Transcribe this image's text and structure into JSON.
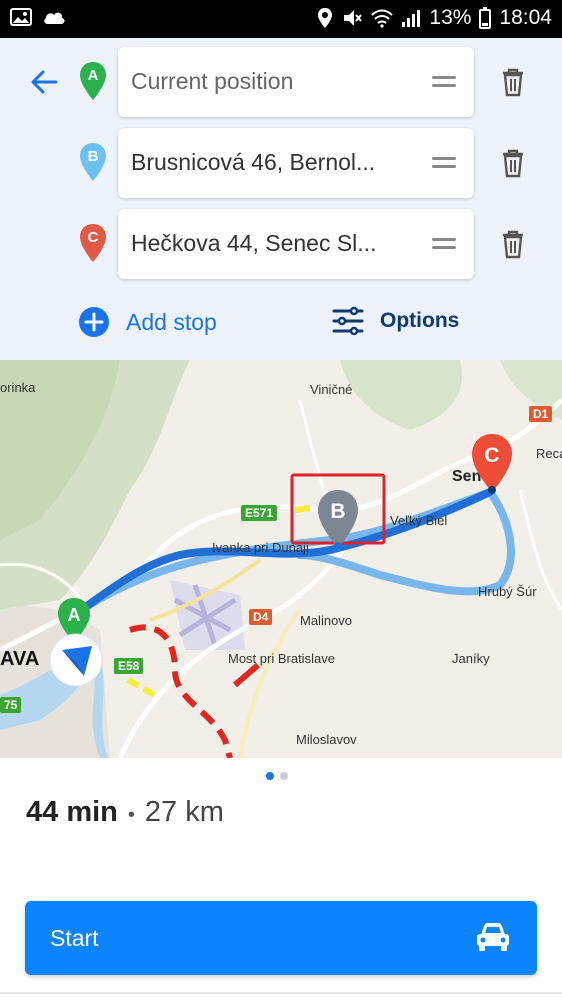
{
  "status_bar": {
    "battery": "13%",
    "time": "18:04",
    "icons": [
      "image-icon",
      "cloud-icon",
      "location-icon",
      "mute-icon",
      "wifi-icon",
      "signal-icon",
      "battery-icon"
    ]
  },
  "route": {
    "stops": [
      {
        "marker": "A",
        "marker_color": "#2bb24c",
        "value": "Current position",
        "is_placeholder": true
      },
      {
        "marker": "B",
        "marker_color": "#6cc1ee",
        "value": "Brusnicová 46, Bernol...",
        "is_placeholder": false
      },
      {
        "marker": "C",
        "marker_color": "#e05a45",
        "value": "Hečkova 44, Senec Sl...",
        "is_placeholder": false
      }
    ],
    "add_stop_label": "Add stop",
    "options_label": "Options"
  },
  "map": {
    "labels": {
      "vinicne": "Viničné",
      "porinka": "orinka",
      "ivanka": "Ivanka pri Dunaji",
      "velky_biel": "Veľký Biel",
      "hruby_sur": "Hrubý Šúr",
      "malinovo": "Malinovo",
      "most": "Most pri Bratislave",
      "janiky": "Janíky",
      "miloslavov": "Miloslavov",
      "reca": "Reca",
      "senec": "Senec",
      "ava": "AVA"
    },
    "badges": {
      "d1": "D1",
      "d4": "D4",
      "e571": "E571",
      "e58": "E58",
      "left75": "75"
    },
    "markers": {
      "a": "A",
      "b": "B",
      "c": "C"
    },
    "colors": {
      "route": "#1f6fd6",
      "alt_route": "#78b7ee",
      "highlight_box": "#e0202a"
    }
  },
  "pager": {
    "count": 2,
    "active": 0
  },
  "summary": {
    "duration": "44 min",
    "separator": "•",
    "distance": "27 km"
  },
  "start_label": "Start",
  "colors": {
    "accent": "#0a84ff",
    "panel_bg": "#eef2fa"
  }
}
